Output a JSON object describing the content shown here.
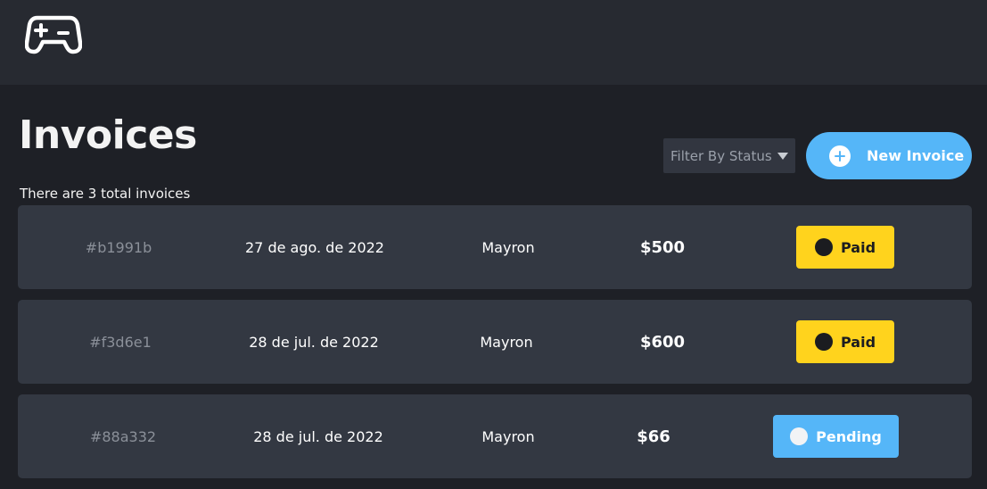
{
  "header": {
    "logo_icon": "gamepad-icon"
  },
  "page": {
    "title": "Invoices",
    "subtitle": "There are 3 total invoices"
  },
  "toolbar": {
    "filter_label": "Filter By Status",
    "new_invoice_label": "New Invoice",
    "new_invoice_icon": "plus-circle-icon"
  },
  "invoices": [
    {
      "id": "#b1991b",
      "date": "27 de ago. de 2022",
      "client": "Mayron",
      "amount": "$500",
      "status": "Paid"
    },
    {
      "id": "#f3d6e1",
      "date": "28 de jul. de 2022",
      "client": "Mayron",
      "amount": "$600",
      "status": "Paid"
    },
    {
      "id": "#88a332",
      "date": "28 de jul. de 2022",
      "client": "Mayron",
      "amount": "$66",
      "status": "Pending"
    }
  ],
  "colors": {
    "background": "#1e2026",
    "topbar": "#272a31",
    "row": "#333842",
    "accent_blue": "#55b6f8",
    "paid_yellow": "#ffd31d"
  }
}
